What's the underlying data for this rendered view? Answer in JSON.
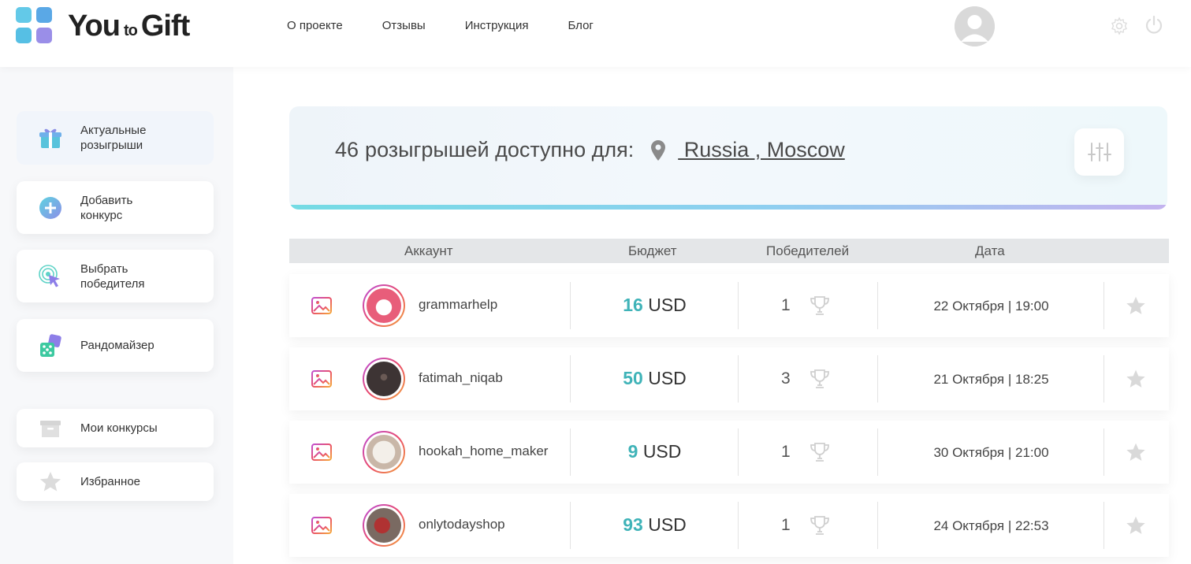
{
  "header": {
    "logo": {
      "you": "You",
      "to": "to",
      "gift": "Gift"
    },
    "nav": [
      "О проекте",
      "Отзывы",
      "Инструкция",
      "Блог"
    ]
  },
  "sidebar": {
    "items": [
      {
        "label": "Актуальные\nрозыгрыши",
        "icon": "gift-icon"
      },
      {
        "label": "Добавить\nконкурс",
        "icon": "plus-circle-icon"
      },
      {
        "label": "Выбрать\nпобедителя",
        "icon": "target-cursor-icon"
      },
      {
        "label": "Рандомайзер",
        "icon": "dice-icon"
      },
      {
        "label": "Мои конкурсы",
        "icon": "archive-box-icon"
      },
      {
        "label": "Избранное",
        "icon": "star-icon"
      }
    ]
  },
  "banner": {
    "count": "46",
    "text": "розыгрышей доступно для:",
    "location": " Russia , Moscow"
  },
  "table": {
    "headers": {
      "account": "Аккаунт",
      "budget": "Бюджет",
      "winners": "Победителей",
      "date": "Дата"
    },
    "rows": [
      {
        "account": "grammarhelp",
        "amount": "16",
        "currency": "USD",
        "winners": "1",
        "date": "22 Октября | 19:00"
      },
      {
        "account": "fatimah_niqab",
        "amount": "50",
        "currency": "USD",
        "winners": "3",
        "date": "21 Октября | 18:25"
      },
      {
        "account": "hookah_home_maker",
        "amount": "9",
        "currency": "USD",
        "winners": "1",
        "date": "30 Октября | 21:00"
      },
      {
        "account": "onlytodayshop",
        "amount": "93",
        "currency": "USD",
        "winners": "1",
        "date": "24 Октября | 22:53"
      }
    ]
  },
  "colors": {
    "accent": "#3fb3b8",
    "banner_gradient_start": "#74dbe4",
    "banner_gradient_end": "#c4b3ef"
  }
}
